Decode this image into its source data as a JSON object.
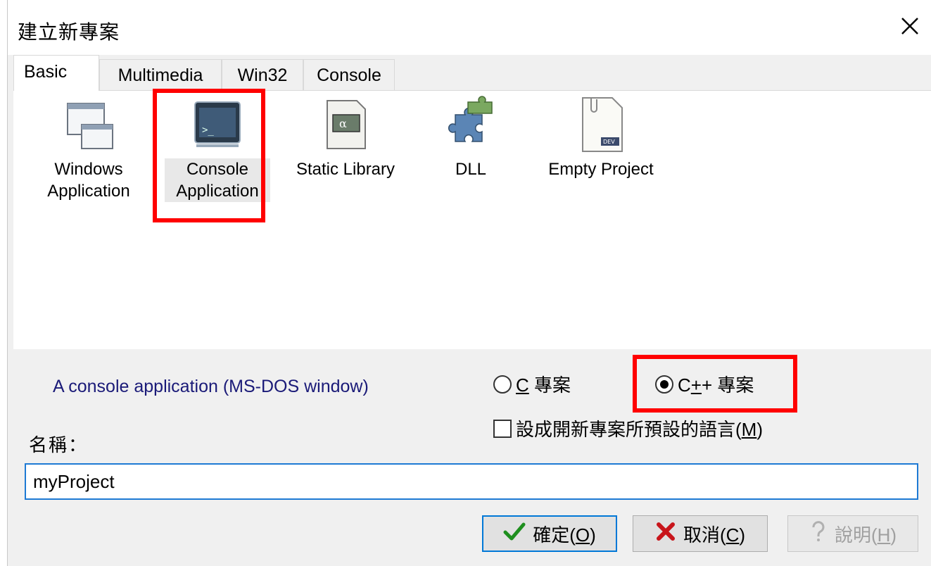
{
  "window": {
    "title": "建立新專案"
  },
  "tabs": [
    {
      "label": "Basic",
      "active": true
    },
    {
      "label": "Multimedia"
    },
    {
      "label": "Win32"
    },
    {
      "label": "Console"
    }
  ],
  "templates": [
    {
      "label_line1": "Windows",
      "label_line2": "Application",
      "icon": "windows-app-icon"
    },
    {
      "label_line1": "Console",
      "label_line2": "Application",
      "icon": "console-app-icon",
      "selected": true
    },
    {
      "label_line1": "Static Library",
      "label_line2": "",
      "icon": "static-library-icon"
    },
    {
      "label_line1": "DLL",
      "label_line2": "",
      "icon": "puzzle-icon"
    },
    {
      "label_line1": "Empty Project",
      "label_line2": "",
      "icon": "dev-file-icon"
    }
  ],
  "description": "A console application (MS-DOS window)",
  "language": {
    "c_label_prefix": "C",
    "c_label_suffix": " 專案",
    "cpp_label_prefix": "C",
    "cpp_label_plus1": "+",
    "cpp_label_suffix": "+ 專案",
    "selected": "C++"
  },
  "default_checkbox": {
    "label_main": "設成開新專案所預設的語言(",
    "label_key": "M",
    "label_end": ")",
    "checked": false
  },
  "name": {
    "label": "名稱：",
    "value": "myProject"
  },
  "buttons": {
    "ok": {
      "label_main": "確定(",
      "key": "O",
      "end": ")"
    },
    "cancel": {
      "label_main": "取消(",
      "key": "C",
      "end": ")"
    },
    "help": {
      "label_main": "說明(",
      "key": "H",
      "end": ")",
      "enabled": false
    }
  },
  "colors": {
    "highlight": "#ff0000",
    "description_text": "#1a1a78",
    "focus_border": "#1e7ad4"
  }
}
